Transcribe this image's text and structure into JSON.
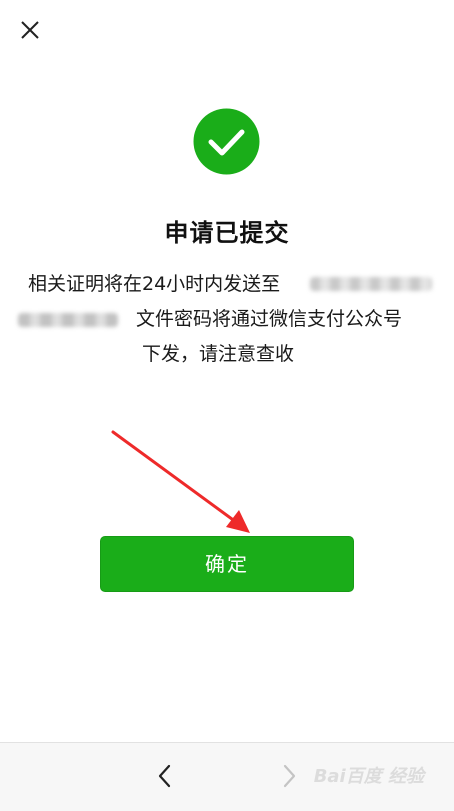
{
  "header": {
    "close_icon": "close-icon"
  },
  "status": {
    "icon": "check-circle-icon",
    "color": "#1aad19",
    "title": "申请已提交"
  },
  "message": {
    "line1_text": "相关证明将在24小时内发送至",
    "line2_text": "文件密码将通过微信支付公众号",
    "line3_text": "下发，请注意查收"
  },
  "actions": {
    "confirm_label": "确定",
    "confirm_color": "#1aad19"
  },
  "annotation": {
    "arrow_color": "#ee2a2a"
  },
  "navigation": {
    "back_icon": "chevron-left-icon",
    "forward_icon": "chevron-right-icon"
  },
  "watermark": {
    "text": "Bai百度 经验"
  }
}
